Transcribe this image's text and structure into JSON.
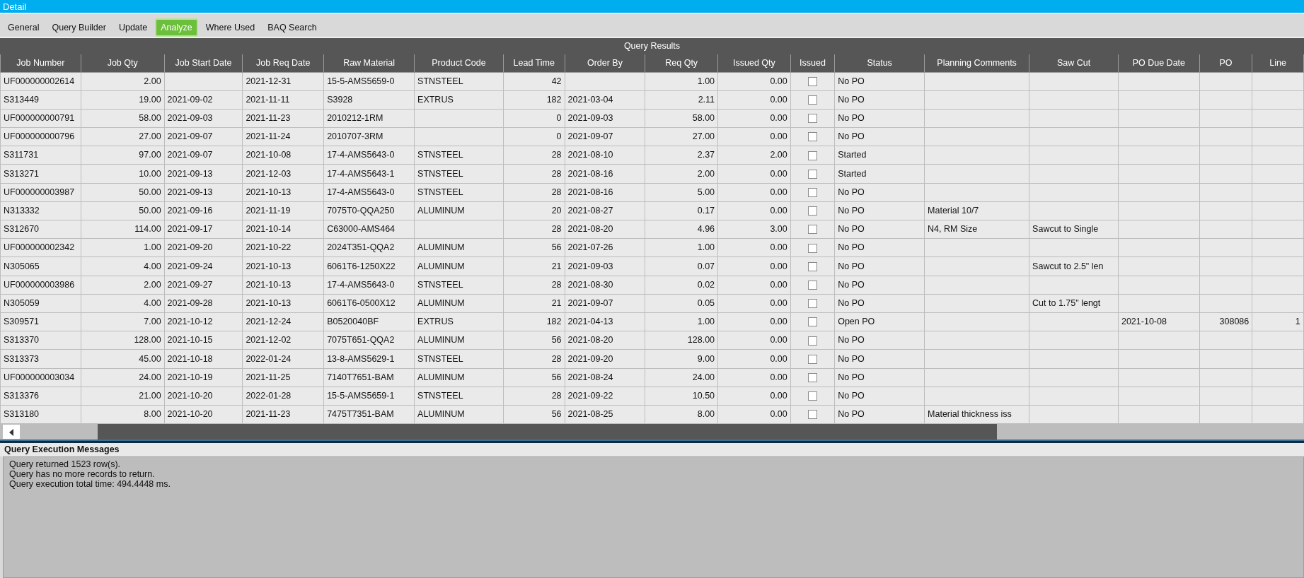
{
  "window": {
    "title": "Detail"
  },
  "tabs": [
    {
      "label": "General",
      "selected": false
    },
    {
      "label": "Query Builder",
      "selected": false
    },
    {
      "label": "Update",
      "selected": false
    },
    {
      "label": "Analyze",
      "selected": true
    },
    {
      "label": "Where Used",
      "selected": false
    },
    {
      "label": "BAQ Search",
      "selected": false
    }
  ],
  "results": {
    "title": "Query Results",
    "columns": [
      {
        "label": "Job Number",
        "kind": "text"
      },
      {
        "label": "Job Qty",
        "kind": "number"
      },
      {
        "label": "Job Start Date",
        "kind": "text"
      },
      {
        "label": "Job Req Date",
        "kind": "text"
      },
      {
        "label": "Raw Material",
        "kind": "text"
      },
      {
        "label": "Product Code",
        "kind": "text"
      },
      {
        "label": "Lead Time",
        "kind": "number"
      },
      {
        "label": "Order By",
        "kind": "text"
      },
      {
        "label": "Req Qty",
        "kind": "number"
      },
      {
        "label": "Issued Qty",
        "kind": "number"
      },
      {
        "label": "Issued",
        "kind": "checkbox"
      },
      {
        "label": "Status",
        "kind": "text"
      },
      {
        "label": "Planning Comments",
        "kind": "text"
      },
      {
        "label": "Saw Cut",
        "kind": "text"
      },
      {
        "label": "PO Due Date",
        "kind": "text"
      },
      {
        "label": "PO",
        "kind": "number"
      },
      {
        "label": "Line",
        "kind": "number"
      }
    ],
    "rows": [
      {
        "cells": [
          "UF000000002614",
          "2.00",
          null,
          "2021-12-31",
          "15-5-AMS5659-0",
          "STNSTEEL",
          "42",
          null,
          "1.00",
          "0.00",
          null,
          "No PO",
          null,
          null,
          null,
          null,
          null
        ],
        "issued": false
      },
      {
        "cells": [
          "S313449",
          "19.00",
          "2021-09-02",
          "2021-11-11",
          "S3928",
          "EXTRUS",
          "182",
          "2021-03-04",
          "2.11",
          "0.00",
          null,
          "No PO",
          null,
          null,
          null,
          null,
          null
        ],
        "issued": false
      },
      {
        "cells": [
          "UF000000000791",
          "58.00",
          "2021-09-03",
          "2021-11-23",
          "2010212-1RM",
          null,
          "0",
          "2021-09-03",
          "58.00",
          "0.00",
          null,
          "No PO",
          null,
          null,
          null,
          null,
          null
        ],
        "issued": false
      },
      {
        "cells": [
          "UF000000000796",
          "27.00",
          "2021-09-07",
          "2021-11-24",
          "2010707-3RM",
          null,
          "0",
          "2021-09-07",
          "27.00",
          "0.00",
          null,
          "No PO",
          null,
          null,
          null,
          null,
          null
        ],
        "issued": false
      },
      {
        "cells": [
          "S311731",
          "97.00",
          "2021-09-07",
          "2021-10-08",
          "17-4-AMS5643-0",
          "STNSTEEL",
          "28",
          "2021-08-10",
          "2.37",
          "2.00",
          null,
          "Started",
          null,
          null,
          null,
          null,
          null
        ],
        "issued": false
      },
      {
        "cells": [
          "S313271",
          "10.00",
          "2021-09-13",
          "2021-12-03",
          "17-4-AMS5643-1",
          "STNSTEEL",
          "28",
          "2021-08-16",
          "2.00",
          "0.00",
          null,
          "Started",
          null,
          null,
          null,
          null,
          null
        ],
        "issued": false
      },
      {
        "cells": [
          "UF000000003987",
          "50.00",
          "2021-09-13",
          "2021-10-13",
          "17-4-AMS5643-0",
          "STNSTEEL",
          "28",
          "2021-08-16",
          "5.00",
          "0.00",
          null,
          "No PO",
          null,
          null,
          null,
          null,
          null
        ],
        "issued": false
      },
      {
        "cells": [
          "N313332",
          "50.00",
          "2021-09-16",
          "2021-11-19",
          "7075T0-QQA250",
          "ALUMINUM",
          "20",
          "2021-08-27",
          "0.17",
          "0.00",
          null,
          "No PO",
          "Material 10/7",
          null,
          null,
          null,
          null
        ],
        "issued": false
      },
      {
        "cells": [
          "S312670",
          "114.00",
          "2021-09-17",
          "2021-10-14",
          "C63000-AMS464",
          null,
          "28",
          "2021-08-20",
          "4.96",
          "3.00",
          null,
          "No PO",
          "N4, RM Size",
          "Sawcut to Single",
          null,
          null,
          null
        ],
        "issued": false
      },
      {
        "cells": [
          "UF000000002342",
          "1.00",
          "2021-09-20",
          "2021-10-22",
          "2024T351-QQA2",
          "ALUMINUM",
          "56",
          "2021-07-26",
          "1.00",
          "0.00",
          null,
          "No PO",
          null,
          null,
          null,
          null,
          null
        ],
        "issued": false
      },
      {
        "cells": [
          "N305065",
          "4.00",
          "2021-09-24",
          "2021-10-13",
          "6061T6-1250X22",
          "ALUMINUM",
          "21",
          "2021-09-03",
          "0.07",
          "0.00",
          null,
          "No PO",
          null,
          "Sawcut to 2.5\" len",
          null,
          null,
          null
        ],
        "issued": false
      },
      {
        "cells": [
          "UF000000003986",
          "2.00",
          "2021-09-27",
          "2021-10-13",
          "17-4-AMS5643-0",
          "STNSTEEL",
          "28",
          "2021-08-30",
          "0.02",
          "0.00",
          null,
          "No PO",
          null,
          null,
          null,
          null,
          null
        ],
        "issued": false
      },
      {
        "cells": [
          "N305059",
          "4.00",
          "2021-09-28",
          "2021-10-13",
          "6061T6-0500X12",
          "ALUMINUM",
          "21",
          "2021-09-07",
          "0.05",
          "0.00",
          null,
          "No PO",
          null,
          "Cut to 1.75\" lengt",
          null,
          null,
          null
        ],
        "issued": false
      },
      {
        "cells": [
          "S309571",
          "7.00",
          "2021-10-12",
          "2021-12-24",
          "B0520040BF",
          "EXTRUS",
          "182",
          "2021-04-13",
          "1.00",
          "0.00",
          null,
          "Open PO",
          null,
          null,
          "2021-10-08",
          "308086",
          "1"
        ],
        "issued": false
      },
      {
        "cells": [
          "S313370",
          "128.00",
          "2021-10-15",
          "2021-12-02",
          "7075T651-QQA2",
          "ALUMINUM",
          "56",
          "2021-08-20",
          "128.00",
          "0.00",
          null,
          "No PO",
          null,
          null,
          null,
          null,
          null
        ],
        "issued": false
      },
      {
        "cells": [
          "S313373",
          "45.00",
          "2021-10-18",
          "2022-01-24",
          "13-8-AMS5629-1",
          "STNSTEEL",
          "28",
          "2021-09-20",
          "9.00",
          "0.00",
          null,
          "No PO",
          null,
          null,
          null,
          null,
          null
        ],
        "issued": false
      },
      {
        "cells": [
          "UF000000003034",
          "24.00",
          "2021-10-19",
          "2021-11-25",
          "7140T7651-BAM",
          "ALUMINUM",
          "56",
          "2021-08-24",
          "24.00",
          "0.00",
          null,
          "No PO",
          null,
          null,
          null,
          null,
          null
        ],
        "issued": false
      },
      {
        "cells": [
          "S313376",
          "21.00",
          "2021-10-20",
          "2022-01-28",
          "15-5-AMS5659-1",
          "STNSTEEL",
          "28",
          "2021-09-22",
          "10.50",
          "0.00",
          null,
          "No PO",
          null,
          null,
          null,
          null,
          null
        ],
        "issued": false
      },
      {
        "cells": [
          "S313180",
          "8.00",
          "2021-10-20",
          "2021-11-23",
          "7475T7351-BAM",
          "ALUMINUM",
          "56",
          "2021-08-25",
          "8.00",
          "0.00",
          null,
          "No PO",
          "Material thickness iss",
          null,
          null,
          null,
          null
        ],
        "issued": false
      }
    ]
  },
  "messages": {
    "title": "Query Execution Messages",
    "lines": [
      "Query returned 1523 row(s).",
      "Query has no more records to return.",
      "Query execution total time: 494.4448 ms."
    ]
  }
}
